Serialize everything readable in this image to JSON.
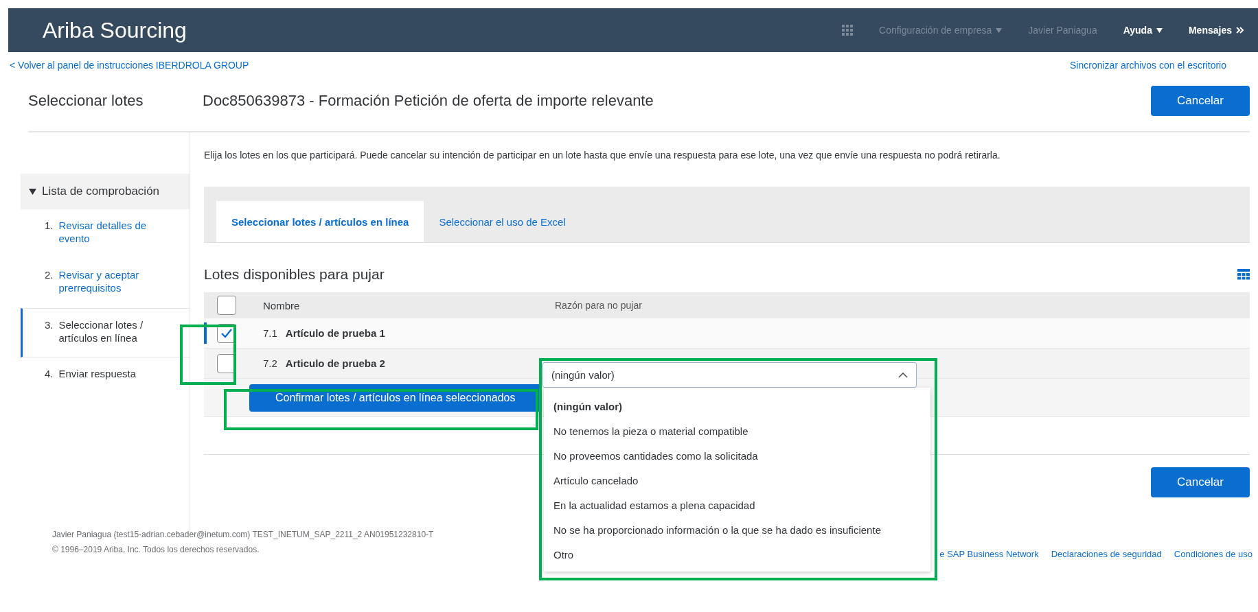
{
  "header": {
    "logo": "Ariba Sourcing",
    "nav": [
      {
        "label": "Configuración de empresa",
        "kind": "menu",
        "dimmed": true
      },
      {
        "label": "Javier Paniagua",
        "kind": "text",
        "dimmed": true
      },
      {
        "label": "Ayuda",
        "kind": "menu",
        "dimmed": false
      },
      {
        "label": "Mensajes",
        "kind": "more",
        "dimmed": false
      }
    ]
  },
  "back_link": "< Volver al panel de instrucciones IBERDROLA GROUP",
  "sync_link": "Sincronizar archivos con el escritorio",
  "page_title": "Seleccionar lotes",
  "document_title": "Doc850639873 - Formación Petición de oferta de importe relevante",
  "cancel_button": "Cancelar",
  "checklist": {
    "title": "Lista de comprobación",
    "expanded": true,
    "items": [
      {
        "number": "1.",
        "label": "Revisar detalles de evento",
        "selected": false,
        "link": true
      },
      {
        "number": "2.",
        "label": "Revisar y aceptar prerrequisitos",
        "selected": false,
        "link": true
      },
      {
        "number": "3.",
        "label": "Seleccionar lotes / artículos en línea",
        "selected": true,
        "link": false
      },
      {
        "number": "4.",
        "label": "Enviar respuesta",
        "selected": false,
        "link": false
      }
    ]
  },
  "instructions": "Elija los lotes en los que participará. Puede cancelar su intención de participar en un lote hasta que envíe una respuesta para ese lote, una vez que envíe una respuesta no podrá retirarla.",
  "tabs": [
    {
      "label": "Seleccionar lotes / artículos en línea",
      "selected": true
    },
    {
      "label": "Seleccionar el uso de Excel",
      "selected": false
    }
  ],
  "section_title": "Lotes disponibles para pujar",
  "table": {
    "select_all_checked": false,
    "columns": [
      "Nombre",
      "Razón para no pujar"
    ],
    "rows": [
      {
        "number": "7.1",
        "name": "Artículo de prueba 1",
        "checked": true,
        "focused": true
      },
      {
        "number": "7.2",
        "name": "Articulo de prueba 2",
        "checked": false,
        "focused": false
      }
    ]
  },
  "confirm_button": "Confirmar lotes / artículos en línea seleccionados",
  "reason_dropdown": {
    "value": "(ningún valor)",
    "expanded": true,
    "options": [
      {
        "label": "(ningún valor)",
        "selected": true
      },
      {
        "label": "No tenemos la pieza o material compatible",
        "selected": false
      },
      {
        "label": "No proveemos cantidades como la solicitada",
        "selected": false
      },
      {
        "label": "Artículo cancelado",
        "selected": false
      },
      {
        "label": "En la actualidad estamos a plena capacidad",
        "selected": false
      },
      {
        "label": "No se ha proporcionado información o la que se ha dado es insuficiente",
        "selected": false
      },
      {
        "label": "Otro",
        "selected": false
      }
    ]
  },
  "bottom_cancel_button": "Cancelar",
  "footer": {
    "user_line": "Javier Paniagua (test15-adrian.cebader@inetum.com)   TEST_INETUM_SAP_2211_2  AN01951232810-T",
    "copyright": "© 1996–2019 Ariba, Inc. Todos los derechos reservados.",
    "links": [
      "e SAP Business Network",
      "Declaraciones de seguridad",
      "Condiciones de uso"
    ]
  }
}
